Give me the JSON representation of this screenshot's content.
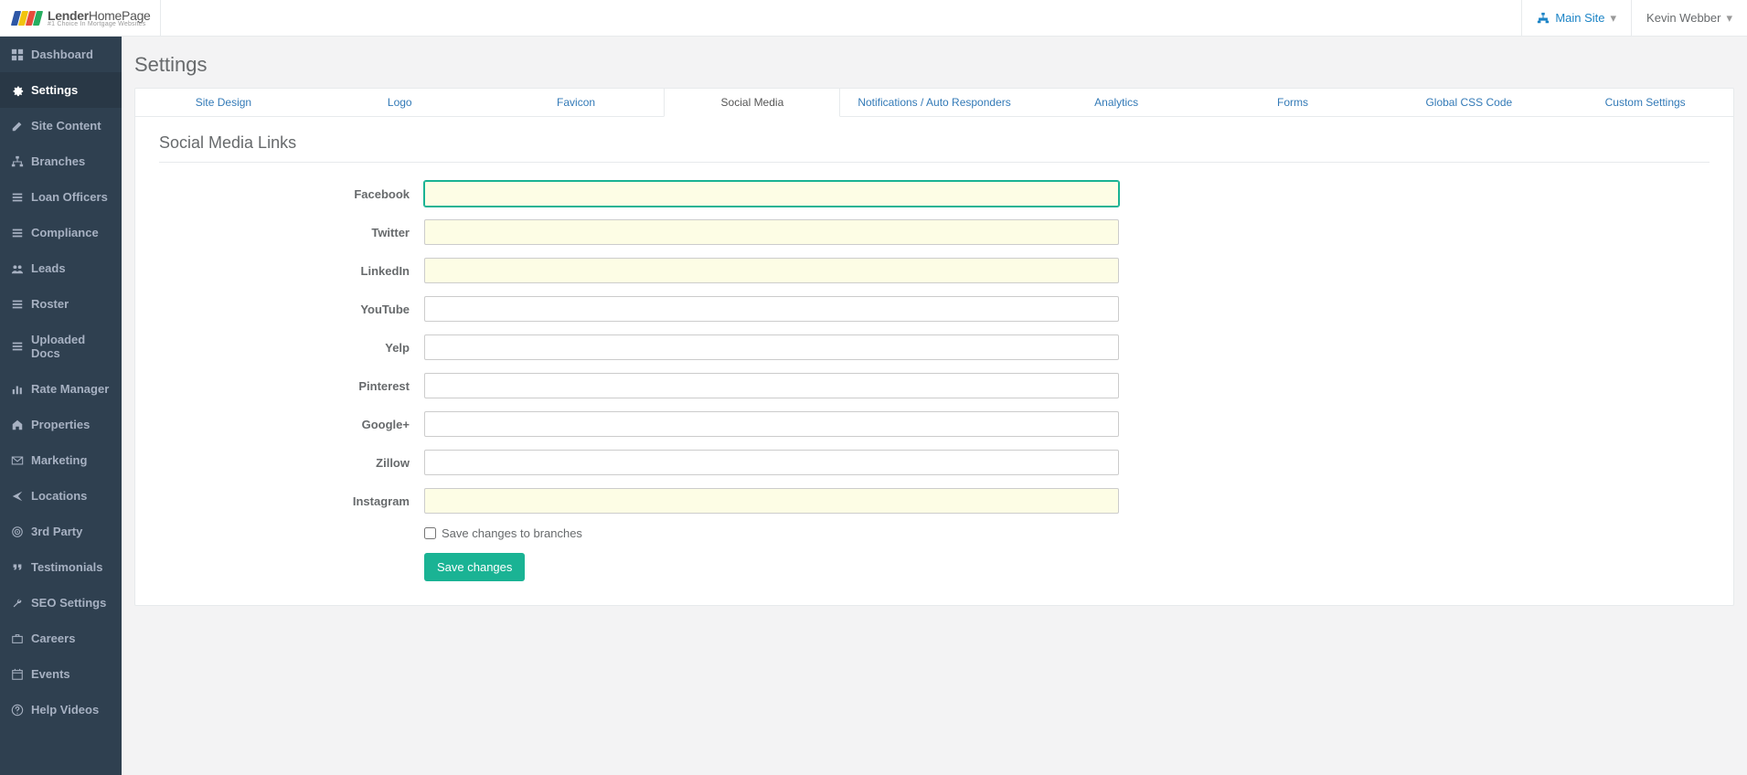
{
  "brand": {
    "name1": "Lender",
    "name2": "Home",
    "name3": "Page",
    "tagline": "#1 Choice In Mortgage Websites"
  },
  "topbar": {
    "site_switcher": "Main Site",
    "user_name": "Kevin Webber"
  },
  "sidebar": {
    "items": [
      {
        "label": "Dashboard",
        "icon": "dashboard"
      },
      {
        "label": "Settings",
        "icon": "gear"
      },
      {
        "label": "Site Content",
        "icon": "edit"
      },
      {
        "label": "Branches",
        "icon": "sitemap"
      },
      {
        "label": "Loan Officers",
        "icon": "list"
      },
      {
        "label": "Compliance",
        "icon": "list"
      },
      {
        "label": "Leads",
        "icon": "users"
      },
      {
        "label": "Roster",
        "icon": "list"
      },
      {
        "label": "Uploaded Docs",
        "icon": "list"
      },
      {
        "label": "Rate Manager",
        "icon": "chart"
      },
      {
        "label": "Properties",
        "icon": "home"
      },
      {
        "label": "Marketing",
        "icon": "mail"
      },
      {
        "label": "Locations",
        "icon": "arrow"
      },
      {
        "label": "3rd Party",
        "icon": "target"
      },
      {
        "label": "Testimonials",
        "icon": "quote"
      },
      {
        "label": "SEO Settings",
        "icon": "wrench"
      },
      {
        "label": "Careers",
        "icon": "briefcase"
      },
      {
        "label": "Events",
        "icon": "calendar"
      },
      {
        "label": "Help Videos",
        "icon": "help"
      }
    ],
    "active_index": 1
  },
  "page": {
    "title": "Settings",
    "section_title": "Social Media Links",
    "tabs": [
      "Site Design",
      "Logo",
      "Favicon",
      "Social Media",
      "Notifications / Auto Responders",
      "Analytics",
      "Forms",
      "Global CSS Code",
      "Custom Settings"
    ],
    "active_tab": "Social Media"
  },
  "form": {
    "fields": [
      {
        "label": "Facebook",
        "value": "",
        "autofill": true,
        "focused": true
      },
      {
        "label": "Twitter",
        "value": "",
        "autofill": true,
        "focused": false
      },
      {
        "label": "LinkedIn",
        "value": "",
        "autofill": true,
        "focused": false
      },
      {
        "label": "YouTube",
        "value": "",
        "autofill": false,
        "focused": false
      },
      {
        "label": "Yelp",
        "value": "",
        "autofill": false,
        "focused": false
      },
      {
        "label": "Pinterest",
        "value": "",
        "autofill": false,
        "focused": false
      },
      {
        "label": "Google+",
        "value": "",
        "autofill": false,
        "focused": false
      },
      {
        "label": "Zillow",
        "value": "",
        "autofill": false,
        "focused": false
      },
      {
        "label": "Instagram",
        "value": "",
        "autofill": true,
        "focused": false
      }
    ],
    "checkbox_label": "Save changes to branches",
    "checkbox_checked": false,
    "save_label": "Save changes"
  }
}
